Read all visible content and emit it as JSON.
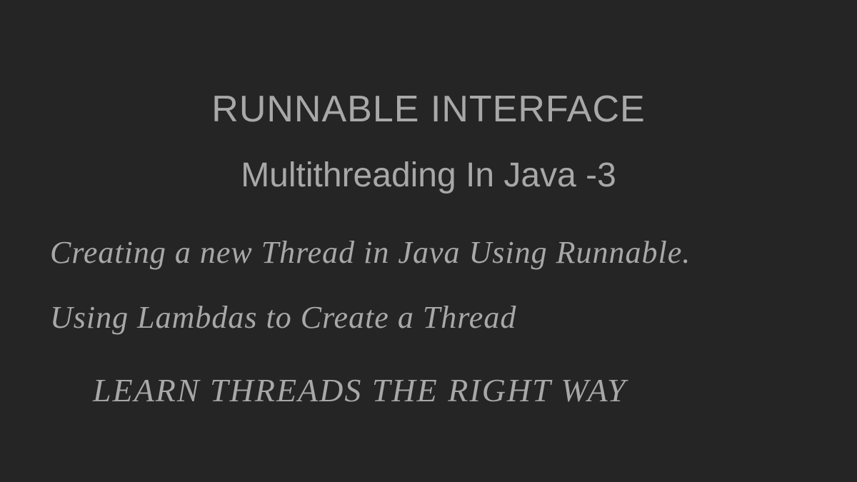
{
  "slide": {
    "title": "RUNNABLE INTERFACE",
    "subtitle": "Multithreading In Java -3",
    "line1": "Creating a new Thread in Java Using Runnable.",
    "line2": "Using Lambdas to Create a Thread",
    "footer": "LEARN THREADS THE RIGHT WAY"
  },
  "colors": {
    "background": "#252525",
    "text": "#a8a8a8"
  }
}
